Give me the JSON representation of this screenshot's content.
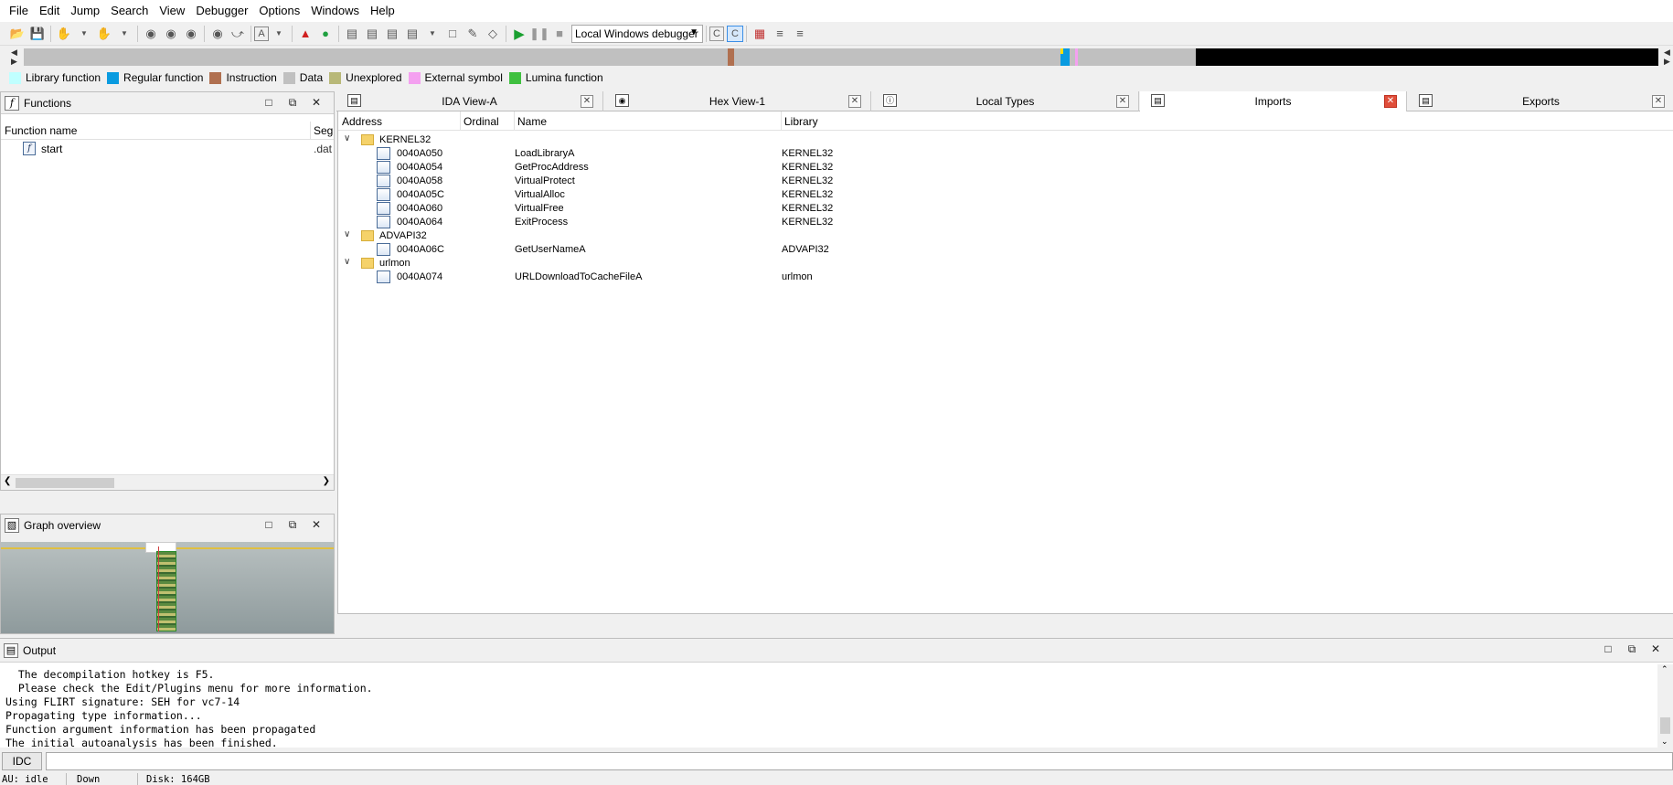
{
  "menu": [
    "File",
    "Edit",
    "Jump",
    "Search",
    "View",
    "Debugger",
    "Options",
    "Windows",
    "Help"
  ],
  "toolbar": {
    "debugger_select": "Local Windows debugger"
  },
  "navband": {
    "colors": {
      "unexplored": "#c0c0c0",
      "instruction": "#b07050",
      "regular": "#0a9be0",
      "external": "#f4a0f0",
      "data": "#000000"
    }
  },
  "legend": [
    {
      "label": "Library function",
      "color": "#c0ffff"
    },
    {
      "label": "Regular function",
      "color": "#0a9be0"
    },
    {
      "label": "Instruction",
      "color": "#b07050"
    },
    {
      "label": "Data",
      "color": "#c0c0c0"
    },
    {
      "label": "Unexplored",
      "color": "#b8b878"
    },
    {
      "label": "External symbol",
      "color": "#f4a0f0"
    },
    {
      "label": "Lumina function",
      "color": "#40c040"
    }
  ],
  "functions": {
    "title": "Functions",
    "col_name": "Function name",
    "col_seg": "Seg",
    "rows": [
      {
        "name": "start",
        "seg": ".dat"
      }
    ]
  },
  "graph": {
    "title": "Graph overview"
  },
  "tabs": [
    {
      "label": "IDA View-A",
      "active": false
    },
    {
      "label": "Hex View-1",
      "active": false
    },
    {
      "label": "Local Types",
      "active": false
    },
    {
      "label": "Imports",
      "active": true
    },
    {
      "label": "Exports",
      "active": false
    }
  ],
  "imports": {
    "columns": [
      "Address",
      "Ordinal",
      "Name",
      "Library"
    ],
    "groups": [
      {
        "name": "KERNEL32",
        "rows": [
          {
            "address": "0040A050",
            "name": "LoadLibraryA",
            "library": "KERNEL32"
          },
          {
            "address": "0040A054",
            "name": "GetProcAddress",
            "library": "KERNEL32"
          },
          {
            "address": "0040A058",
            "name": "VirtualProtect",
            "library": "KERNEL32"
          },
          {
            "address": "0040A05C",
            "name": "VirtualAlloc",
            "library": "KERNEL32"
          },
          {
            "address": "0040A060",
            "name": "VirtualFree",
            "library": "KERNEL32"
          },
          {
            "address": "0040A064",
            "name": "ExitProcess",
            "library": "KERNEL32"
          }
        ]
      },
      {
        "name": "ADVAPI32",
        "rows": [
          {
            "address": "0040A06C",
            "name": "GetUserNameA",
            "library": "ADVAPI32"
          }
        ]
      },
      {
        "name": "urlmon",
        "rows": [
          {
            "address": "0040A074",
            "name": "URLDownloadToCacheFileA",
            "library": "urlmon"
          }
        ]
      }
    ]
  },
  "output": {
    "title": "Output",
    "lines": [
      "  The decompilation hotkey is F5.",
      "  Please check the Edit/Plugins menu for more information.",
      "Using FLIRT signature: SEH for vc7-14",
      "Propagating type information...",
      "Function argument information has been propagated",
      "The initial autoanalysis has been finished."
    ]
  },
  "idc": {
    "button": "IDC"
  },
  "status": {
    "au": "AU:  idle",
    "dir": "Down",
    "disk": "Disk: 164GB"
  }
}
